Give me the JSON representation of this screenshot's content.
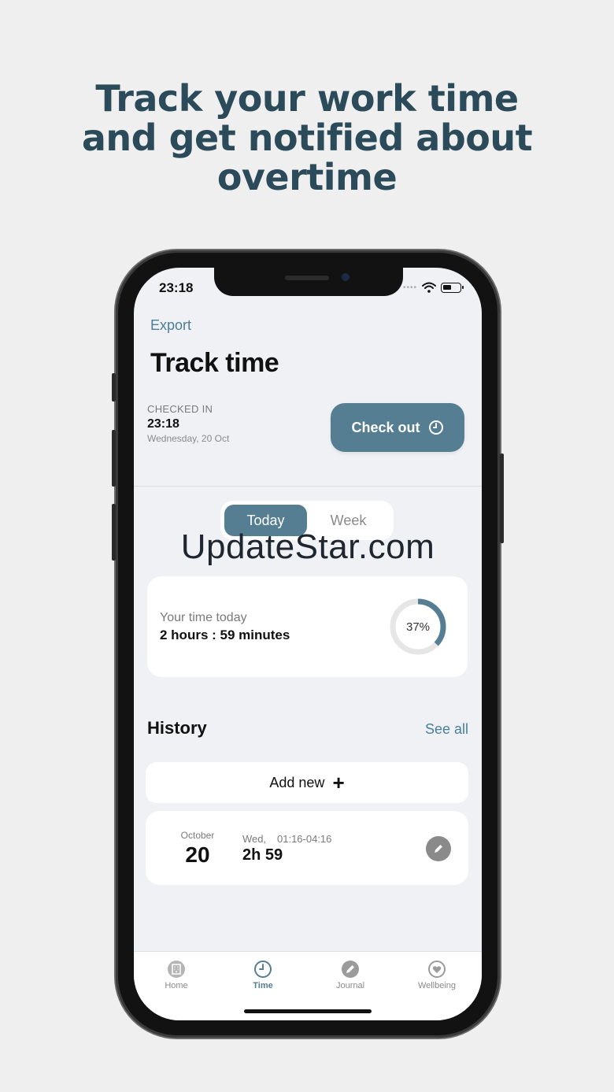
{
  "headline": [
    "Track your work time",
    "and get notified about",
    "overtime"
  ],
  "status_bar": {
    "time": "23:18",
    "signal": "••••"
  },
  "header": {
    "export_label": "Export",
    "title": "Track time"
  },
  "checkin": {
    "label": "CHECKED IN",
    "time": "23:18",
    "date": "Wednesday, 20 Oct",
    "button_label": "Check out"
  },
  "segments": [
    "Today",
    "Week"
  ],
  "selected_segment": "Today",
  "watermark": "UpdateStar.com",
  "today_card": {
    "label": "Your time today",
    "value": "2 hours : 59 minutes",
    "progress_text": "37%",
    "progress_fraction": 0.37
  },
  "history": {
    "title": "History",
    "see_all_label": "See all",
    "add_new_label": "Add new",
    "entries": [
      {
        "month": "October",
        "day": "20",
        "weekday": "Wed,",
        "range": "01:16-04:16",
        "duration": "2h 59"
      }
    ]
  },
  "tabbar": {
    "items": [
      {
        "label": "Home",
        "icon": "building-icon"
      },
      {
        "label": "Time",
        "icon": "clock-icon"
      },
      {
        "label": "Journal",
        "icon": "pencil-icon"
      },
      {
        "label": "Wellbeing",
        "icon": "heart-icon"
      }
    ],
    "active": "Time"
  },
  "colors": {
    "accent": "#557e93",
    "headline": "#2b4a5a",
    "link": "#4b7f98",
    "background": "#efefef"
  }
}
